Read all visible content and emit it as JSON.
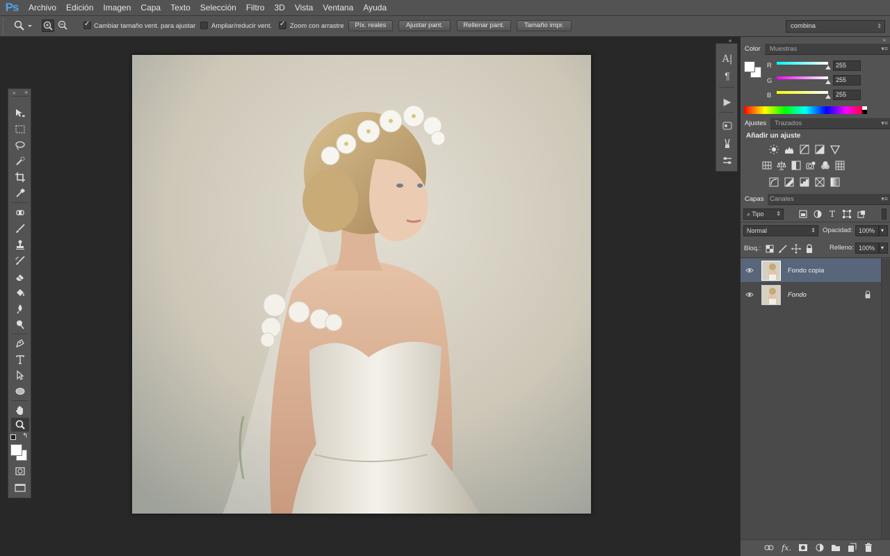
{
  "app": {
    "logo": "Ps"
  },
  "menu": [
    "Archivo",
    "Edición",
    "Imagen",
    "Capa",
    "Texto",
    "Selección",
    "Filtro",
    "3D",
    "Vista",
    "Ventana",
    "Ayuda"
  ],
  "options": {
    "resize_windows": {
      "label": "Cambiar tamaño vent. para ajustar",
      "checked": true
    },
    "zoom_all": {
      "label": "Ampliar/reducir vent.",
      "checked": false
    },
    "scrubby_zoom": {
      "label": "Zoom con arrastre",
      "checked": true
    },
    "buttons": [
      "Píx. reales",
      "Ajustar pant.",
      "Rellenar pant.",
      "Tamaño impr."
    ],
    "workspace": "combina"
  },
  "colors": {
    "accent_logo": "#4fa3e8",
    "panel": "#535353",
    "selected_layer": "#58657a"
  },
  "color_panel": {
    "tabs": [
      "Color",
      "Muestras"
    ],
    "channels": [
      {
        "label": "R",
        "value": "255"
      },
      {
        "label": "G",
        "value": "255"
      },
      {
        "label": "B",
        "value": "255"
      }
    ]
  },
  "adjustments_panel": {
    "tabs": [
      "Ajustes",
      "Trazados"
    ],
    "heading": "Añadir un ajuste"
  },
  "layers_panel": {
    "tabs": [
      "Capas",
      "Canales"
    ],
    "filter_kind": "Tipo",
    "blend_mode": "Normal",
    "opacity_label": "Opacidad:",
    "opacity": "100%",
    "lock_label": "Bloq.:",
    "fill_label": "Relleno:",
    "fill": "100%",
    "layers": [
      {
        "name": "Fondo copia",
        "selected": true,
        "locked": false,
        "visible": true
      },
      {
        "name": "Fondo",
        "selected": false,
        "locked": true,
        "visible": true
      }
    ],
    "footer_icons": [
      "link-icon",
      "fx-icon",
      "mask-icon",
      "adjustment-icon",
      "group-icon",
      "new-layer-icon",
      "trash-icon"
    ]
  },
  "document": {
    "image_subject": "bride-portrait"
  }
}
